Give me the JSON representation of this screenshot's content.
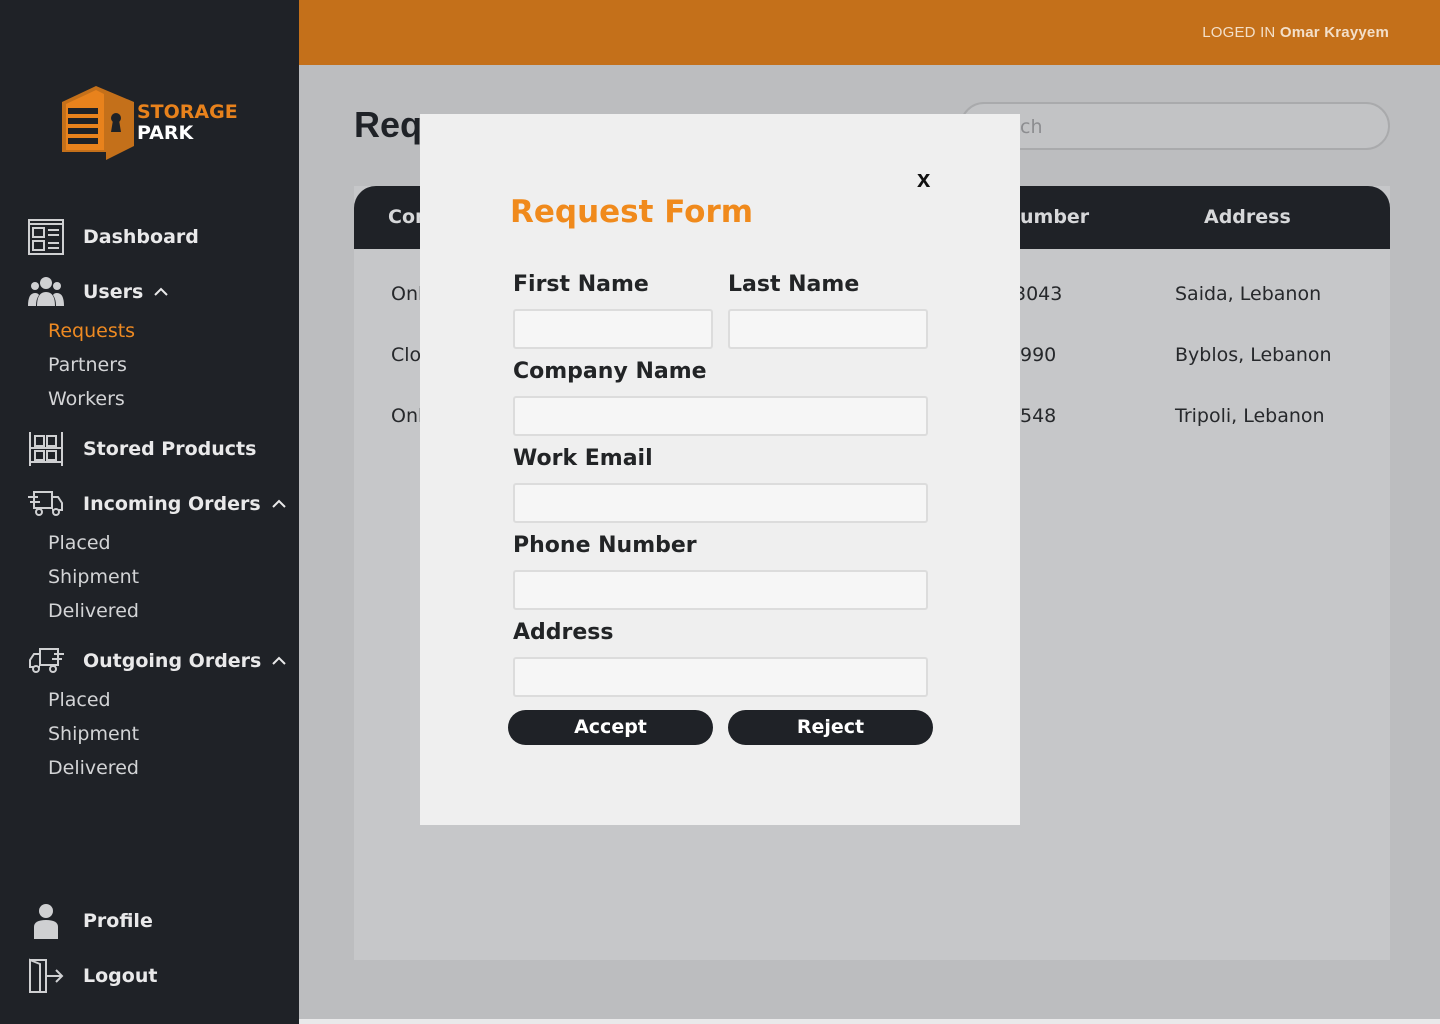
{
  "brand": {
    "line1": "STORAGE",
    "line2": "PARK",
    "accent": "#e8821c"
  },
  "topbar": {
    "logged_label": "LOGED IN",
    "user_name": "Omar Krayyem",
    "color": "#c4701a"
  },
  "sidebar": {
    "dashboard": {
      "label": "Dashboard",
      "icon": "dashboard-icon"
    },
    "users": {
      "label": "Users",
      "icon": "users-icon",
      "subitems": [
        "Requests",
        "Partners",
        "Workers"
      ],
      "active": "Requests"
    },
    "stored_products": {
      "label": "Stored Products",
      "icon": "shelves-icon"
    },
    "incoming": {
      "label": "Incoming Orders",
      "icon": "delivery-truck-icon",
      "subitems": [
        "Placed",
        "Shipment",
        "Delivered"
      ]
    },
    "outgoing": {
      "label": "Outgoing Orders",
      "icon": "truck-out-icon",
      "subitems": [
        "Placed",
        "Shipment",
        "Delivered"
      ]
    },
    "profile": {
      "label": "Profile",
      "icon": "person-icon"
    },
    "logout": {
      "label": "Logout",
      "icon": "logout-icon"
    }
  },
  "main": {
    "title_visible": "Req",
    "search_visible_text": "ch",
    "headers": {
      "col1_visible": "Cor",
      "col_number_visible": "umber",
      "address": "Address"
    },
    "rows": [
      {
        "col1_visible": "Onl",
        "number_visible": "3043",
        "address": "Saida, Lebanon"
      },
      {
        "col1_visible": "Clo",
        "number_visible": "990",
        "address": "Byblos, Lebanon"
      },
      {
        "col1_visible": "Onl",
        "number_visible": "548",
        "address": "Tripoli, Lebanon"
      }
    ]
  },
  "modal": {
    "close_label": "x",
    "title": "Request Form",
    "first_name_label": "First Name",
    "last_name_label": "Last Name",
    "company_label": "Company Name",
    "email_label": "Work Email",
    "phone_label": "Phone Number",
    "address_label": "Address",
    "accept_label": "Accept",
    "reject_label": "Reject"
  }
}
